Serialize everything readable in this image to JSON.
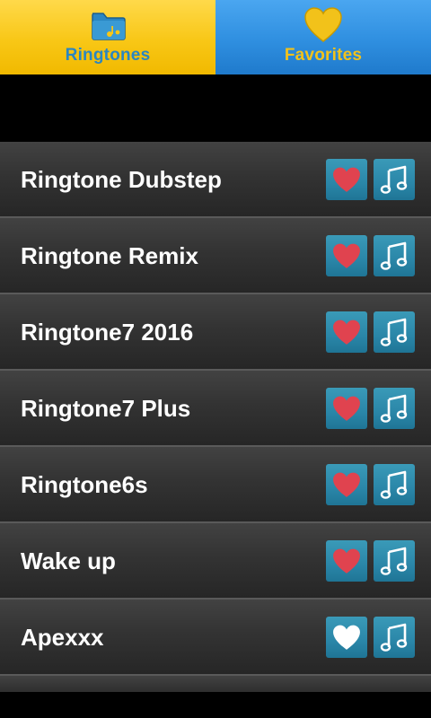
{
  "tabs": [
    {
      "label": "Ringtones",
      "icon": "folder-music-icon",
      "active": true
    },
    {
      "label": "Favorites",
      "icon": "heart-icon",
      "active": false
    }
  ],
  "colors": {
    "ringtones_tab": "#f8c716",
    "favorites_tab": "#2f8fe0",
    "ringtones_label": "#2a86c2",
    "favorites_label": "#f2c21a",
    "button_bg": "#2a86a8",
    "heart_favorited": "#e0434f",
    "heart_not_favorited": "#ffffff"
  },
  "ringtones": [
    {
      "title": "Ringtone Dubstep",
      "favorited": true
    },
    {
      "title": "Ringtone Remix",
      "favorited": true
    },
    {
      "title": "Ringtone7 2016",
      "favorited": true
    },
    {
      "title": "Ringtone7 Plus",
      "favorited": true
    },
    {
      "title": "Ringtone6s",
      "favorited": true
    },
    {
      "title": "Wake up",
      "favorited": true
    },
    {
      "title": "Apexxx",
      "favorited": false
    }
  ]
}
